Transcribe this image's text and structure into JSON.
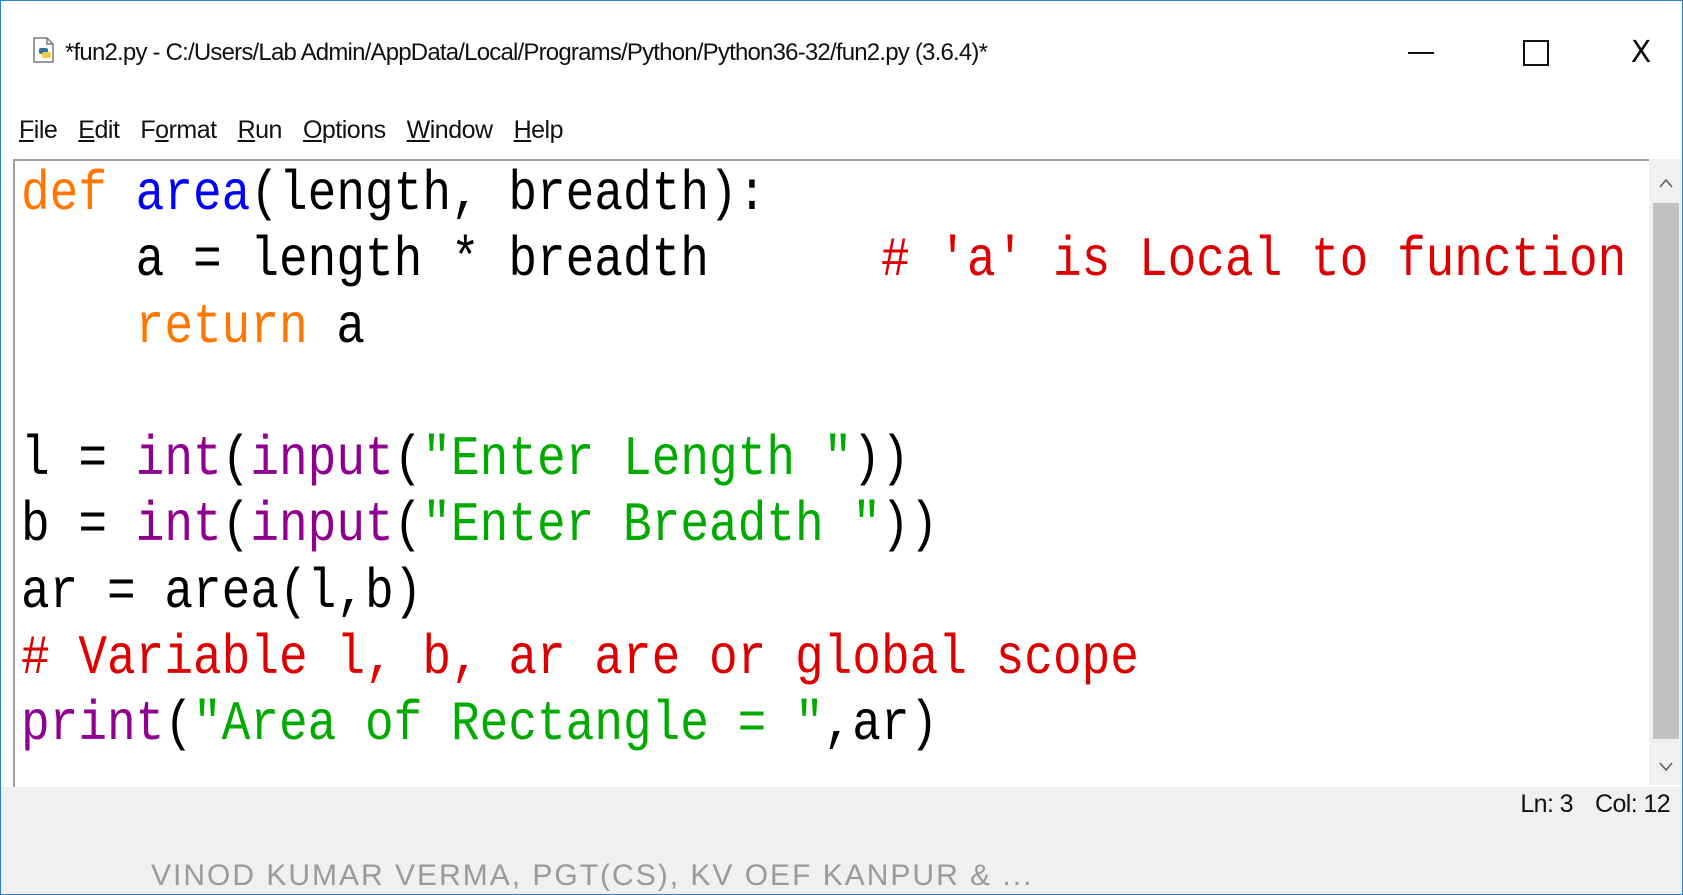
{
  "window": {
    "title": "*fun2.py - C:/Users/Lab Admin/AppData/Local/Programs/Python/Python36-32/fun2.py (3.6.4)*",
    "controls": {
      "minimize": "—",
      "maximize": "☐",
      "close": "X"
    }
  },
  "menu": {
    "items": [
      {
        "label": "File",
        "mnemonic": "F"
      },
      {
        "label": "Edit",
        "mnemonic": "E"
      },
      {
        "label": "Format",
        "mnemonic": "o"
      },
      {
        "label": "Run",
        "mnemonic": "R"
      },
      {
        "label": "Options",
        "mnemonic": "O"
      },
      {
        "label": "Window",
        "mnemonic": "W"
      },
      {
        "label": "Help",
        "mnemonic": "H"
      }
    ]
  },
  "editor": {
    "lines": [
      "def area(length, breadth):",
      "    a = length * breadth      # 'a' is Local to function area",
      "    return a",
      "",
      "l = int(input(\"Enter Length \"))",
      "b = int(input(\"Enter Breadth \"))",
      "ar = area(l,b)",
      "# Variable l, b, ar are or global scope",
      "print(\"Area of Rectangle = \",ar)"
    ],
    "syntax_colors": {
      "keyword": "#ff7700",
      "definition": "#0000ff",
      "builtin": "#900090",
      "string": "#00aa00",
      "comment": "#dd0000",
      "default": "#000000"
    }
  },
  "scrollbar": {
    "up_icon": "chevron-up",
    "down_icon": "chevron-down"
  },
  "status": {
    "line": "Ln: 3",
    "col": "Col: 12"
  },
  "watermark": "VINOD KUMAR VERMA, PGT(CS), KV OEF KANPUR & ..."
}
